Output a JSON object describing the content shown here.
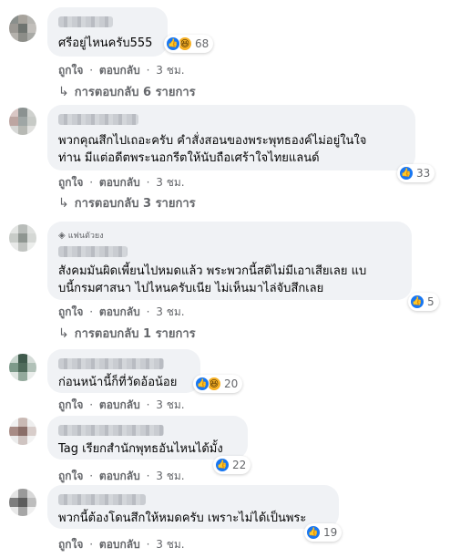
{
  "colors": {
    "bubble": "#f0f2f5",
    "like": "#1877f2",
    "haha": "#f7b125",
    "meta": "#65676b"
  },
  "labels": {
    "like": "ถูกใจ",
    "reply": "ตอบกลับ",
    "dot": "·"
  },
  "comments": [
    {
      "text": "ศรีอยู่ไหนครับ555",
      "reactions": {
        "icons": [
          "like-icon",
          "haha-icon"
        ],
        "count": "68"
      },
      "time": "3 ชม.",
      "replies": "การตอบกลับ 6 รายการ"
    },
    {
      "text": "พวกคุณสึกไปเถอะครับ คำสั่งสอนของพระพุทธองค์ไม่อยู่ในใจ\nท่าน มีแต่อดีตพระนอกรีตให้นับถือเศร้าใจไทยแลนด์",
      "reactions": {
        "icons": [
          "like-icon"
        ],
        "count": "33"
      },
      "time": "3 ชม.",
      "replies": "การตอบกลับ 3 รายการ"
    },
    {
      "badge": "แฟนตัวยง",
      "text": "สังคมมันผิดเพี้ยนไปหมดแล้ว พระพวกนี้สติไม่มีเอาเสียเลย แบ\nบนี้กรมศาสนา ไปไหนครับเนีย ไม่เห็นมาไล่จับสึกเลย",
      "reactions": {
        "icons": [
          "like-icon"
        ],
        "count": "5"
      },
      "time": "3 ชม.",
      "replies": "การตอบกลับ 1 รายการ"
    },
    {
      "text": "ก่อนหน้านี้ก็ที่วัดอ้อน้อย",
      "reactions": {
        "icons": [
          "like-icon",
          "haha-icon"
        ],
        "count": "20"
      },
      "time": "3 ชม."
    },
    {
      "text": "Tag เรียกสำนักพุทธอันไหนได้มั้ง",
      "reactions": {
        "icons": [
          "like-icon"
        ],
        "count": "22"
      },
      "time": "3 ชม."
    },
    {
      "text": "พวกนี้ต้องโดนสึกให้หมดครับ เพราะไม่ได้เป็นพระ",
      "reactions": {
        "icons": [
          "like-icon"
        ],
        "count": "19"
      },
      "time": "3 ชม."
    }
  ]
}
